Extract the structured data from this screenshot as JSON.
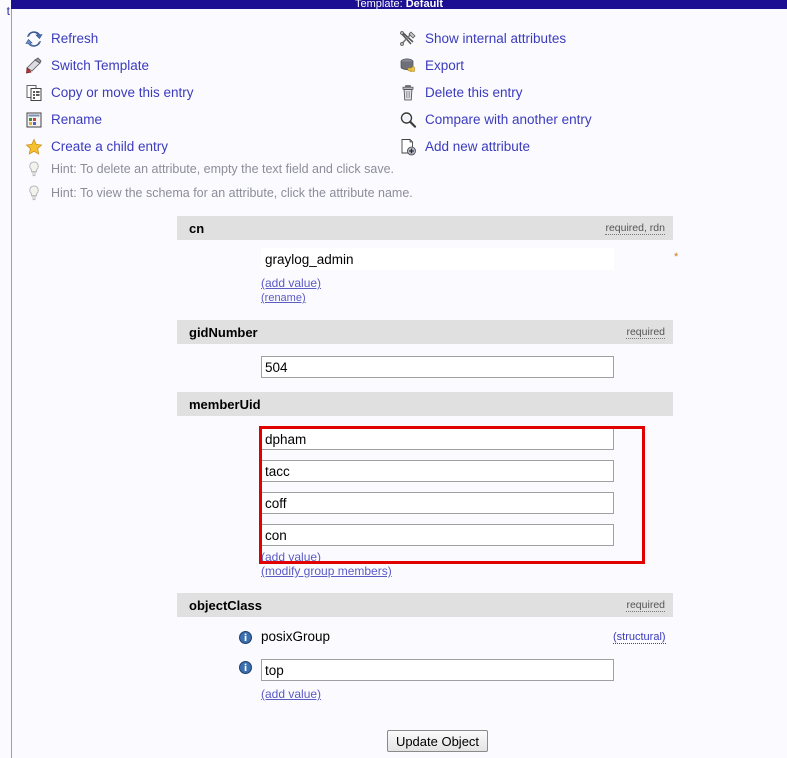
{
  "template_bar": {
    "label": "Template: ",
    "value": "Default"
  },
  "left_stub": {
    "text": "t"
  },
  "actions": {
    "left_column": [
      {
        "icon": "refresh-icon",
        "label": "Refresh"
      },
      {
        "icon": "switch-template-icon",
        "label": "Switch Template"
      },
      {
        "icon": "copy-move-icon",
        "label": "Copy or move this entry"
      },
      {
        "icon": "rename-icon",
        "label": "Rename"
      },
      {
        "icon": "star-icon",
        "label": "Create a child entry"
      }
    ],
    "right_column": [
      {
        "icon": "tools-icon",
        "label": "Show internal attributes"
      },
      {
        "icon": "export-icon",
        "label": "Export"
      },
      {
        "icon": "trash-icon",
        "label": "Delete this entry"
      },
      {
        "icon": "magnifier-icon",
        "label": "Compare with another entry"
      },
      {
        "icon": "add-attr-icon",
        "label": "Add new attribute"
      }
    ]
  },
  "hints": [
    {
      "icon": "lightbulb-icon",
      "text": "Hint: To delete an attribute, empty the text field and click save."
    },
    {
      "icon": "lightbulb-icon",
      "text": "Hint: To view the schema for an attribute, click the attribute name."
    }
  ],
  "attributes": [
    {
      "name": "cn",
      "flags": "required, rdn",
      "values": [
        "graylog_admin"
      ],
      "readonly": true,
      "mark": "*",
      "links": [
        "(add value)",
        "(rename)"
      ]
    },
    {
      "name": "gidNumber",
      "flags": "required",
      "values": [
        "504"
      ],
      "readonly": false,
      "links": []
    },
    {
      "name": "memberUid",
      "flags": "",
      "values": [
        "dpham",
        "tacc",
        "coff",
        "con"
      ],
      "readonly": false,
      "links": [
        "(add value)",
        "(modify group members)"
      ]
    },
    {
      "name": "objectClass",
      "flags": "required",
      "values": [
        "posixGroup",
        "top"
      ],
      "readonly": false,
      "structural_label": "(structural)",
      "links": [
        "(add value)"
      ]
    }
  ],
  "submit": {
    "label": "Update Object"
  },
  "annotation": {
    "color": "#e00000",
    "target": "memberUid value fields"
  },
  "colors": {
    "link": "#3b3bbd",
    "header_bar": "#1c0f91",
    "attr_header_bg": "#e0e0e0",
    "page_bg": "#fafaff",
    "hint_text": "#8d8d99"
  }
}
